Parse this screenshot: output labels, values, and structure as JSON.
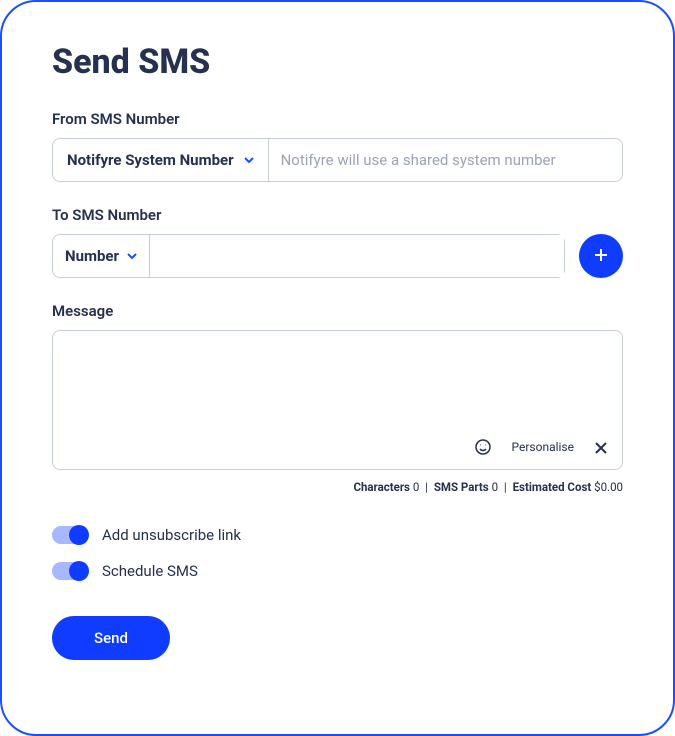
{
  "title": "Send SMS",
  "from": {
    "label": "From SMS Number",
    "selected": "Notifyre System Number",
    "hint": "Notifyre will use a shared system number"
  },
  "to": {
    "label": "To SMS Number",
    "selected": "Number",
    "value": ""
  },
  "message": {
    "label": "Message",
    "value": "",
    "personalise": "Personalise"
  },
  "stats": {
    "characters_label": "Characters",
    "characters_value": "0",
    "parts_label": "SMS Parts",
    "parts_value": "0",
    "cost_label": "Estimated Cost",
    "cost_value": "$0.00"
  },
  "toggles": {
    "unsubscribe": "Add unsubscribe link",
    "schedule": "Schedule SMS"
  },
  "actions": {
    "send": "Send"
  }
}
